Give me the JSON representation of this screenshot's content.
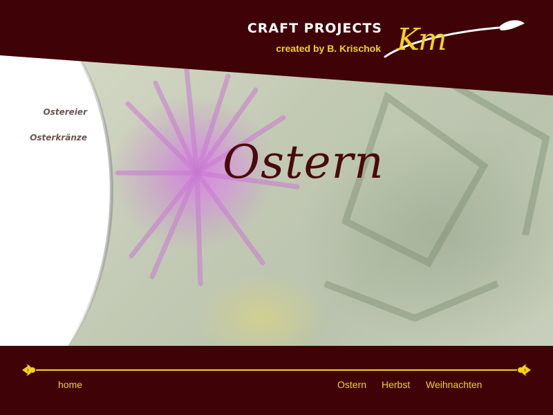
{
  "header": {
    "title": "CRAFT PROJECTS",
    "subtitle": "created by B. Krischok",
    "logo_text": "Km"
  },
  "sidenav": {
    "items": [
      {
        "label": "Ostereier"
      },
      {
        "label": "Osterkränze"
      }
    ]
  },
  "main": {
    "title": "Ostern"
  },
  "footer": {
    "home": "home",
    "links": [
      "Ostern",
      "Herbst",
      "Weihnachten"
    ]
  },
  "colors": {
    "maroon": "#3f0307",
    "accent_yellow": "#f5d21b",
    "title_text": "#4a0a0d"
  }
}
